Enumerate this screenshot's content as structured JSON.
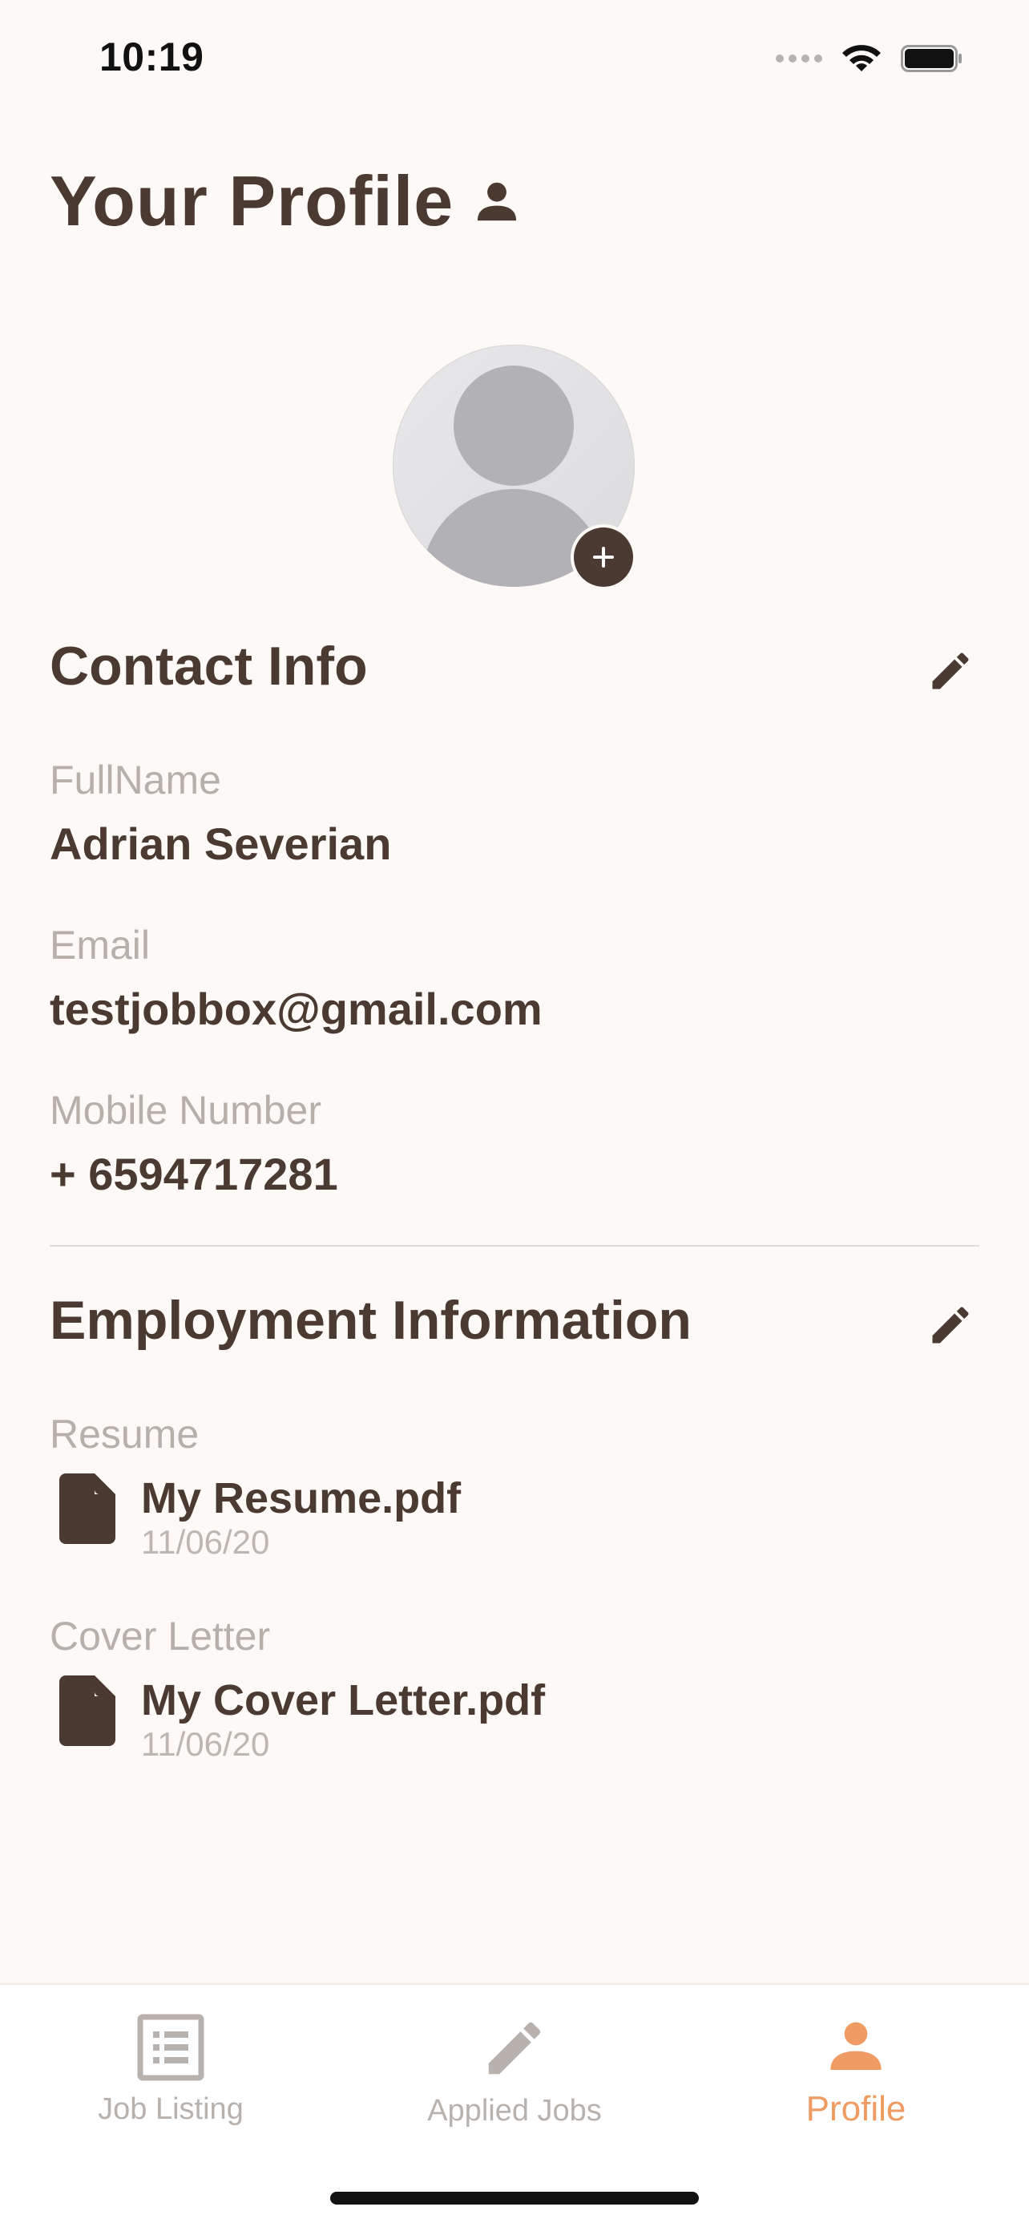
{
  "status_bar": {
    "time": "10:19",
    "icons": [
      "signal-icon",
      "wifi-icon",
      "battery-icon"
    ]
  },
  "header": {
    "title": "Your Profile",
    "title_icon": "person-icon"
  },
  "avatar": {
    "add_icon": "plus-icon"
  },
  "contact_info": {
    "title": "Contact Info",
    "edit_icon": "pencil-icon",
    "full_name_label": "FullName",
    "full_name": "Adrian Severian",
    "email_label": "Email",
    "email": "testjobbox@gmail.com",
    "mobile_label": "Mobile Number",
    "mobile": "+ 6594717281"
  },
  "employment": {
    "title": "Employment Information",
    "edit_icon": "pencil-icon",
    "resume_label": "Resume",
    "resume": {
      "name": "My Resume.pdf",
      "date": "11/06/20"
    },
    "cover_letter_label": "Cover Letter",
    "cover_letter": {
      "name": "My Cover Letter.pdf",
      "date": "11/06/20"
    }
  },
  "tabbar": {
    "tabs": [
      {
        "label": "Job Listing",
        "icon": "list-icon",
        "active": false
      },
      {
        "label": "Applied Jobs",
        "icon": "pencil-icon",
        "active": false
      },
      {
        "label": "Profile",
        "icon": "person-icon",
        "active": true
      }
    ]
  },
  "colors": {
    "background": "#fdf9f6",
    "primary_text": "#4a3a31",
    "muted_text": "#b6afaa",
    "accent": "#ee9c63"
  }
}
